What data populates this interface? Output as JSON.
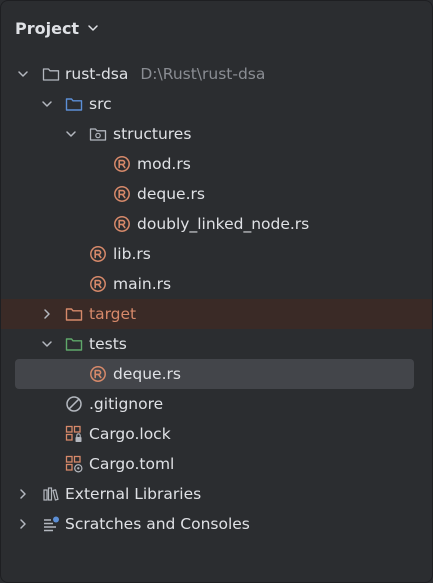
{
  "header": {
    "title": "Project"
  },
  "tree": {
    "root": {
      "label": "rust-dsa",
      "path": "D:\\Rust\\rust-dsa"
    },
    "src": {
      "label": "src"
    },
    "structures": {
      "label": "structures"
    },
    "mod_rs": {
      "label": "mod.rs"
    },
    "deque_rs_struct": {
      "label": "deque.rs"
    },
    "doubly_linked_node_rs": {
      "label": "doubly_linked_node.rs"
    },
    "lib_rs": {
      "label": "lib.rs"
    },
    "main_rs": {
      "label": "main.rs"
    },
    "target": {
      "label": "target"
    },
    "tests": {
      "label": "tests"
    },
    "deque_rs_tests": {
      "label": "deque.rs"
    },
    "gitignore": {
      "label": ".gitignore"
    },
    "cargo_lock": {
      "label": "Cargo.lock"
    },
    "cargo_toml": {
      "label": "Cargo.toml"
    },
    "external_libraries": {
      "label": "External Libraries"
    },
    "scratches": {
      "label": "Scratches and Consoles"
    }
  },
  "colors": {
    "background": "#2b2d30",
    "selection": "#43454a",
    "excluded_row": "#3a2a26",
    "rust_icon": "#d6896a",
    "folder_blue": "#5c8fd6",
    "folder_green": "#5fa86a",
    "text": "#dfe1e5",
    "muted": "#8a8d93"
  }
}
